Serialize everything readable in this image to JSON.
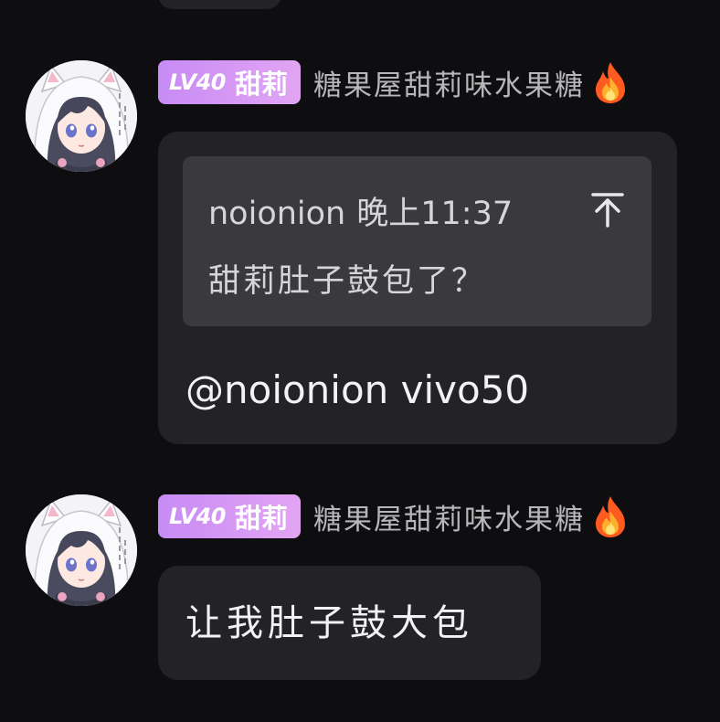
{
  "messages": [
    {
      "user": {
        "level": "LV40",
        "badge_name": "甜莉",
        "nickname": "糖果屋甜莉味水果糖",
        "badge_icon": "fire-icon",
        "avatar": "anime-avatar"
      },
      "quote": {
        "author": "noionion",
        "time": "晚上11:37",
        "text": "甜莉肚子鼓包了？",
        "jump_icon": "arrow-up-to-top-icon"
      },
      "text": "@noionion vivo50"
    },
    {
      "user": {
        "level": "LV40",
        "badge_name": "甜莉",
        "nickname": "糖果屋甜莉味水果糖",
        "badge_icon": "fire-icon",
        "avatar": "anime-avatar"
      },
      "text": "让我肚子鼓大包"
    }
  ],
  "colors": {
    "background": "#0e0e10",
    "bubble": "#232325",
    "quote_block": "#3a3a3d",
    "badge_gradient_start": "#c78bf5",
    "badge_gradient_end": "#e2a5f3",
    "nickname": "#b7b7b9",
    "message_text": "#f2f2f4"
  }
}
